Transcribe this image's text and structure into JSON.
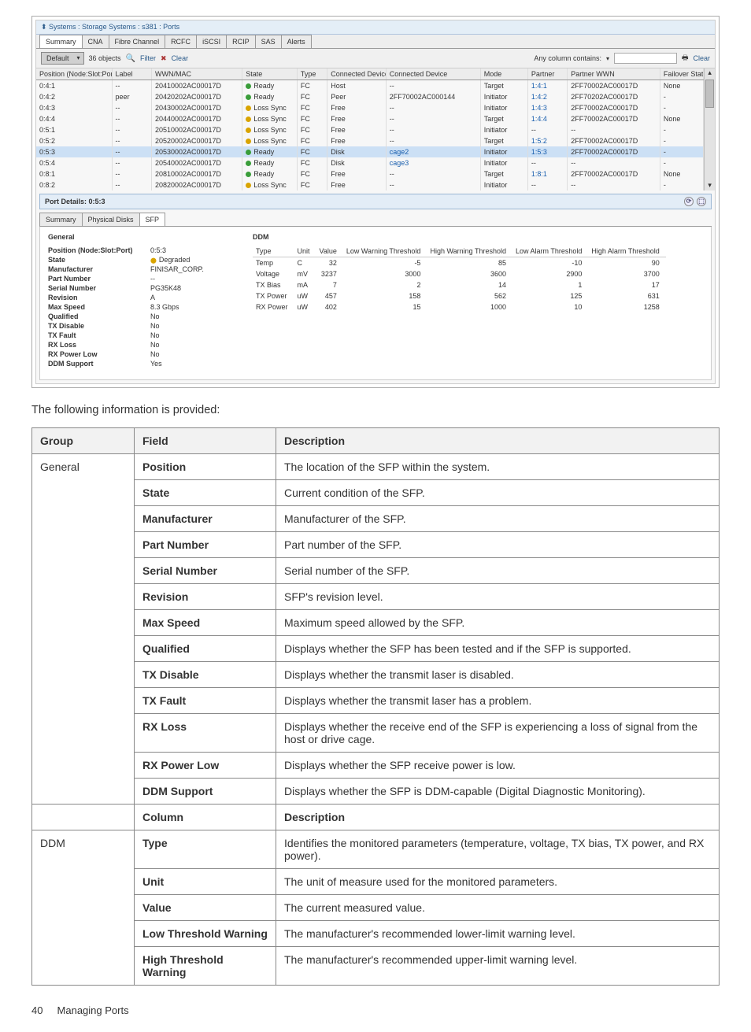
{
  "screenshot": {
    "breadcrumb": "Systems : Storage Systems : s381 : Ports",
    "topTabs": [
      "Summary",
      "CNA",
      "Fibre Channel",
      "RCFC",
      "iSCSI",
      "RCIP",
      "SAS",
      "Alerts"
    ],
    "toolbar": {
      "viewLabel": "Default",
      "objects": "36 objects",
      "filterLabel": "Filter",
      "clearLabel": "Clear",
      "anyColumn": "Any column contains:",
      "clear2": "Clear"
    },
    "columns": [
      "Position (Node:Slot:Port)",
      "Label",
      "WWN/MAC",
      "State",
      "Type",
      "Connected Device Type",
      "Connected Device",
      "Mode",
      "Partner",
      "Partner WWN",
      "Failover State"
    ],
    "rows": [
      {
        "pos": "0:4:1",
        "label": "--",
        "wwn": "20410002AC00017D",
        "state": "Ready",
        "stateClass": "green",
        "type": "FC",
        "cdt": "Host",
        "cd": "--",
        "mode": "Target",
        "partner": "1:4:1",
        "pwwn": "2FF70002AC00017D",
        "fail": "None"
      },
      {
        "pos": "0:4:2",
        "label": "peer",
        "wwn": "20420202AC00017D",
        "state": "Ready",
        "stateClass": "green",
        "type": "FC",
        "cdt": "Peer",
        "cd": "2FF70002AC000144",
        "mode": "Initiator",
        "partner": "1:4:2",
        "pwwn": "2FF70202AC00017D",
        "fail": "-"
      },
      {
        "pos": "0:4:3",
        "label": "--",
        "wwn": "20430002AC00017D",
        "state": "Loss Sync",
        "stateClass": "yellow",
        "type": "FC",
        "cdt": "Free",
        "cd": "--",
        "mode": "Initiator",
        "partner": "1:4:3",
        "pwwn": "2FF70002AC00017D",
        "fail": "-"
      },
      {
        "pos": "0:4:4",
        "label": "--",
        "wwn": "20440002AC00017D",
        "state": "Loss Sync",
        "stateClass": "yellow",
        "type": "FC",
        "cdt": "Free",
        "cd": "--",
        "mode": "Target",
        "partner": "1:4:4",
        "pwwn": "2FF70002AC00017D",
        "fail": "None"
      },
      {
        "pos": "0:5:1",
        "label": "--",
        "wwn": "20510002AC00017D",
        "state": "Loss Sync",
        "stateClass": "yellow",
        "type": "FC",
        "cdt": "Free",
        "cd": "--",
        "mode": "Initiator",
        "partner": "--",
        "pwwn": "--",
        "fail": "-"
      },
      {
        "pos": "0:5:2",
        "label": "--",
        "wwn": "20520002AC00017D",
        "state": "Loss Sync",
        "stateClass": "yellow",
        "type": "FC",
        "cdt": "Free",
        "cd": "--",
        "mode": "Target",
        "partner": "1:5:2",
        "pwwn": "2FF70002AC00017D",
        "fail": "-"
      },
      {
        "pos": "0:5:3",
        "label": "--",
        "wwn": "20530002AC00017D",
        "state": "Ready",
        "stateClass": "green",
        "type": "FC",
        "cdt": "Disk",
        "cd": "cage2",
        "mode": "Initiator",
        "partner": "1:5:3",
        "pwwn": "2FF70002AC00017D",
        "fail": "-",
        "sel": true
      },
      {
        "pos": "0:5:4",
        "label": "--",
        "wwn": "20540002AC00017D",
        "state": "Ready",
        "stateClass": "green",
        "type": "FC",
        "cdt": "Disk",
        "cd": "cage3",
        "mode": "Initiator",
        "partner": "--",
        "pwwn": "--",
        "fail": "-"
      },
      {
        "pos": "0:8:1",
        "label": "--",
        "wwn": "20810002AC00017D",
        "state": "Ready",
        "stateClass": "green",
        "type": "FC",
        "cdt": "Free",
        "cd": "--",
        "mode": "Target",
        "partner": "1:8:1",
        "pwwn": "2FF70002AC00017D",
        "fail": "None"
      },
      {
        "pos": "0:8:2",
        "label": "--",
        "wwn": "20820002AC00017D",
        "state": "Loss Sync",
        "stateClass": "yellow",
        "type": "FC",
        "cdt": "Free",
        "cd": "--",
        "mode": "Initiator",
        "partner": "--",
        "pwwn": "--",
        "fail": "-"
      }
    ],
    "portDetailsTitle": "Port Details: 0:5:3",
    "subTabs": [
      "Summary",
      "Physical Disks",
      "SFP"
    ],
    "general": {
      "title": "General",
      "fields": [
        {
          "k": "Position (Node:Slot:Port)",
          "v": "0:5:3"
        },
        {
          "k": "State",
          "v": "Degraded",
          "cls": "degraded"
        },
        {
          "k": "Manufacturer",
          "v": "FINISAR_CORP."
        },
        {
          "k": "Part Number",
          "v": "--"
        },
        {
          "k": "Serial Number",
          "v": "PG35K48"
        },
        {
          "k": "Revision",
          "v": "A"
        },
        {
          "k": "Max Speed",
          "v": "8.3 Gbps"
        },
        {
          "k": "Qualified",
          "v": "No"
        },
        {
          "k": "TX Disable",
          "v": "No"
        },
        {
          "k": "TX Fault",
          "v": "No"
        },
        {
          "k": "RX Loss",
          "v": "No"
        },
        {
          "k": "RX Power Low",
          "v": "No"
        },
        {
          "k": "DDM Support",
          "v": "Yes"
        }
      ]
    },
    "ddm": {
      "title": "DDM",
      "headers": [
        "Type",
        "Unit",
        "Value",
        "Low Warning Threshold",
        "High Warning Threshold",
        "Low Alarm Threshold",
        "High Alarm Threshold"
      ],
      "rows": [
        {
          "type": "Temp",
          "unit": "C",
          "value": 32,
          "lw": -5,
          "hw": 85,
          "la": -10,
          "ha": 90
        },
        {
          "type": "Voltage",
          "unit": "mV",
          "value": 3237,
          "lw": 3000,
          "hw": 3600,
          "la": 2900,
          "ha": 3700
        },
        {
          "type": "TX Bias",
          "unit": "mA",
          "value": 7,
          "lw": 2,
          "hw": 14,
          "la": 1,
          "ha": 17
        },
        {
          "type": "TX Power",
          "unit": "uW",
          "value": 457,
          "lw": 158,
          "hw": 562,
          "la": 125,
          "ha": 631
        },
        {
          "type": "RX Power",
          "unit": "uW",
          "value": 402,
          "lw": 15,
          "hw": 1000,
          "la": 10,
          "ha": 1258
        }
      ]
    }
  },
  "lead": "The following information is provided:",
  "descTable": {
    "header": [
      "Group",
      "Field",
      "Description"
    ],
    "groups": [
      {
        "group": "General",
        "rows": [
          {
            "field": "Position",
            "desc": "The location of the SFP within the system."
          },
          {
            "field": "State",
            "desc": "Current condition of the SFP."
          },
          {
            "field": "Manufacturer",
            "desc": "Manufacturer of the SFP."
          },
          {
            "field": "Part Number",
            "desc": "Part number of the SFP."
          },
          {
            "field": "Serial Number",
            "desc": "Serial number of the SFP."
          },
          {
            "field": "Revision",
            "desc": "SFP's revision level."
          },
          {
            "field": "Max Speed",
            "desc": "Maximum speed allowed by the SFP."
          },
          {
            "field": "Qualified",
            "desc": "Displays whether the SFP has been tested and if the SFP is supported."
          },
          {
            "field": "TX Disable",
            "desc": "Displays whether the transmit laser is disabled."
          },
          {
            "field": "TX Fault",
            "desc": "Displays whether the transmit laser has a problem."
          },
          {
            "field": "RX Loss",
            "desc": "Displays whether the receive end of the SFP is experiencing a loss of signal from the host or drive cage."
          },
          {
            "field": "RX Power Low",
            "desc": "Displays whether the SFP receive power is low."
          },
          {
            "field": "DDM Support",
            "desc": "Displays whether the SFP is DDM-capable (Digital Diagnostic Monitoring)."
          }
        ]
      }
    ],
    "subHeader": [
      "",
      "Column",
      "Description"
    ],
    "groups2": [
      {
        "group": "DDM",
        "rows": [
          {
            "field": "Type",
            "desc": "Identifies the monitored parameters (temperature, voltage, TX bias, TX power, and RX power)."
          },
          {
            "field": "Unit",
            "desc": "The unit of measure used for the monitored parameters."
          },
          {
            "field": "Value",
            "desc": "The current measured value."
          },
          {
            "field": "Low Threshold Warning",
            "desc": "The manufacturer's recommended lower-limit warning level."
          },
          {
            "field": "High Threshold Warning",
            "desc": "The manufacturer's recommended upper-limit warning level."
          }
        ]
      }
    ]
  },
  "footer": {
    "pageNum": "40",
    "section": "Managing Ports"
  }
}
